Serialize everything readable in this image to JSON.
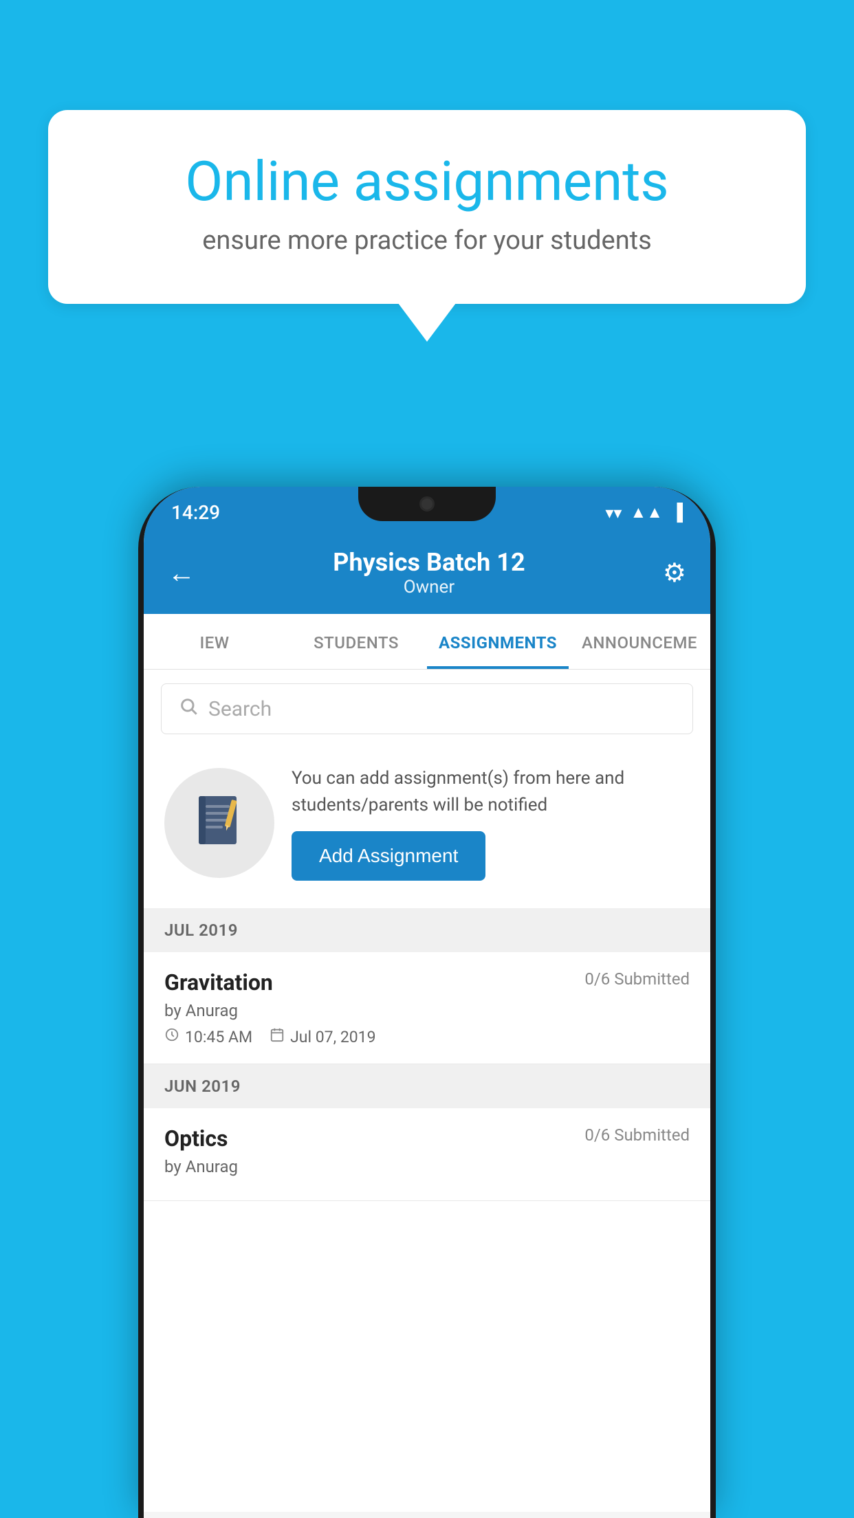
{
  "background_color": "#1ab7ea",
  "speech_bubble": {
    "title": "Online assignments",
    "subtitle": "ensure more practice for your students"
  },
  "status_bar": {
    "time": "14:29",
    "wifi": "▼",
    "signal": "◂",
    "battery": "▌"
  },
  "header": {
    "title": "Physics Batch 12",
    "subtitle": "Owner",
    "back_icon": "←",
    "settings_icon": "⚙"
  },
  "tabs": [
    {
      "label": "IEW",
      "active": false
    },
    {
      "label": "STUDENTS",
      "active": false
    },
    {
      "label": "ASSIGNMENTS",
      "active": true
    },
    {
      "label": "ANNOUNCEME",
      "active": false
    }
  ],
  "search": {
    "placeholder": "Search"
  },
  "promo": {
    "description": "You can add assignment(s) from here and students/parents will be notified",
    "button_label": "Add Assignment"
  },
  "sections": [
    {
      "month": "JUL 2019",
      "assignments": [
        {
          "name": "Gravitation",
          "submitted": "0/6 Submitted",
          "author": "by Anurag",
          "time": "10:45 AM",
          "date": "Jul 07, 2019"
        }
      ]
    },
    {
      "month": "JUN 2019",
      "assignments": [
        {
          "name": "Optics",
          "submitted": "0/6 Submitted",
          "author": "by Anurag",
          "time": "",
          "date": ""
        }
      ]
    }
  ]
}
